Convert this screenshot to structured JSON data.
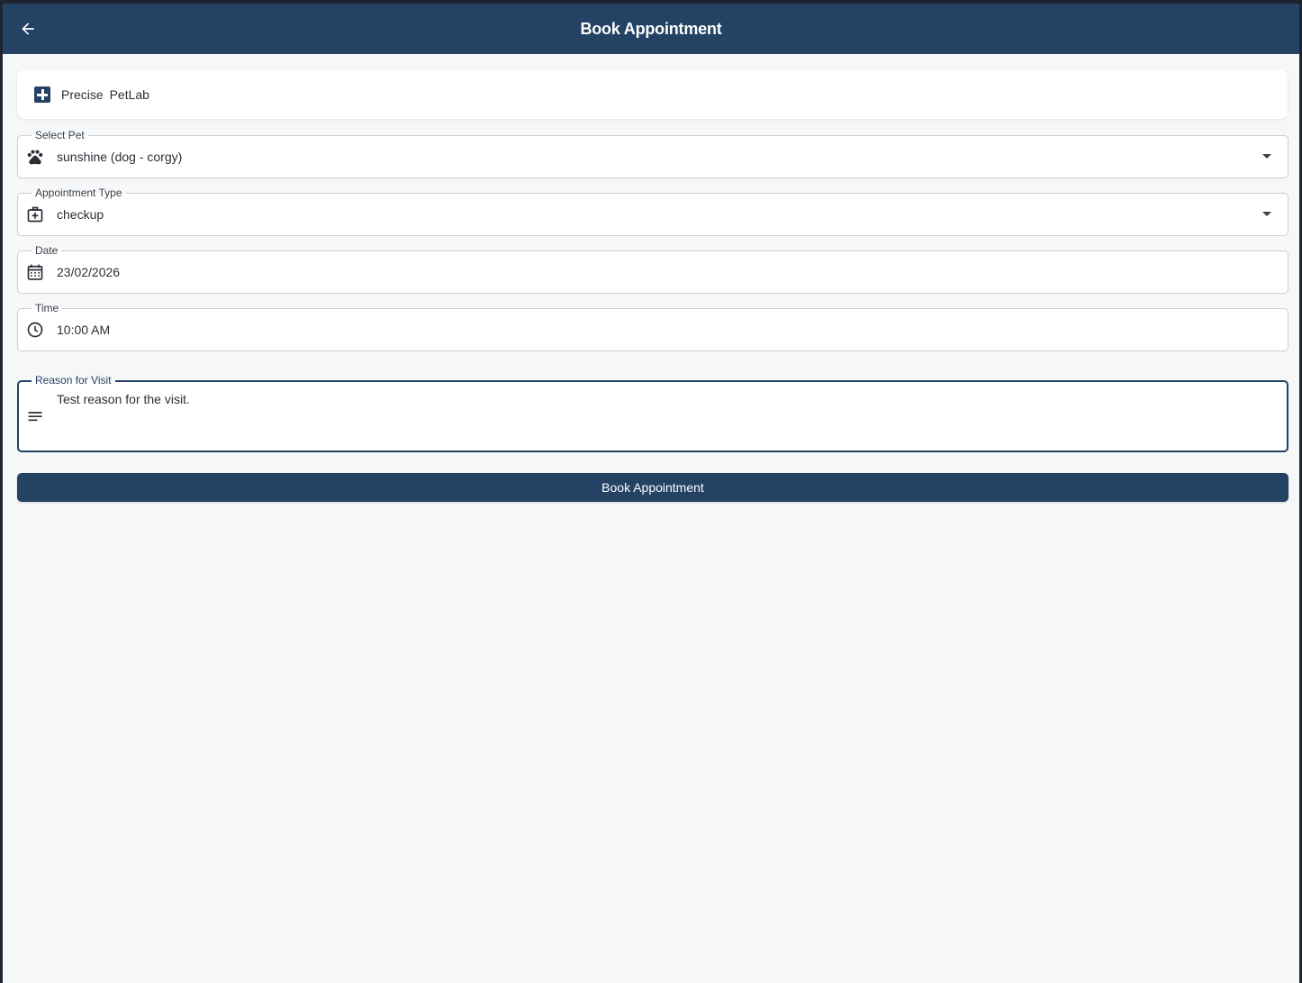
{
  "appbar": {
    "title": "Book Appointment",
    "back_icon": "arrow-left-icon",
    "color": "#244263"
  },
  "clinic": {
    "icon": "medical-cross-icon",
    "name": "Precise  PetLab"
  },
  "form": {
    "pet": {
      "label": "Select Pet",
      "value": "sunshine (dog - corgy)",
      "icon": "paw-icon"
    },
    "appointment_type": {
      "label": "Appointment Type",
      "value": "checkup",
      "icon": "medical-bag-icon"
    },
    "date": {
      "label": "Date",
      "value": "23/02/2026",
      "icon": "calendar-icon"
    },
    "time": {
      "label": "Time",
      "value": "10:00 AM",
      "icon": "clock-icon"
    },
    "reason": {
      "label": "Reason for Visit",
      "value": "Test reason for the visit.",
      "icon": "notes-icon"
    }
  },
  "submit": {
    "label": "Book Appointment"
  }
}
